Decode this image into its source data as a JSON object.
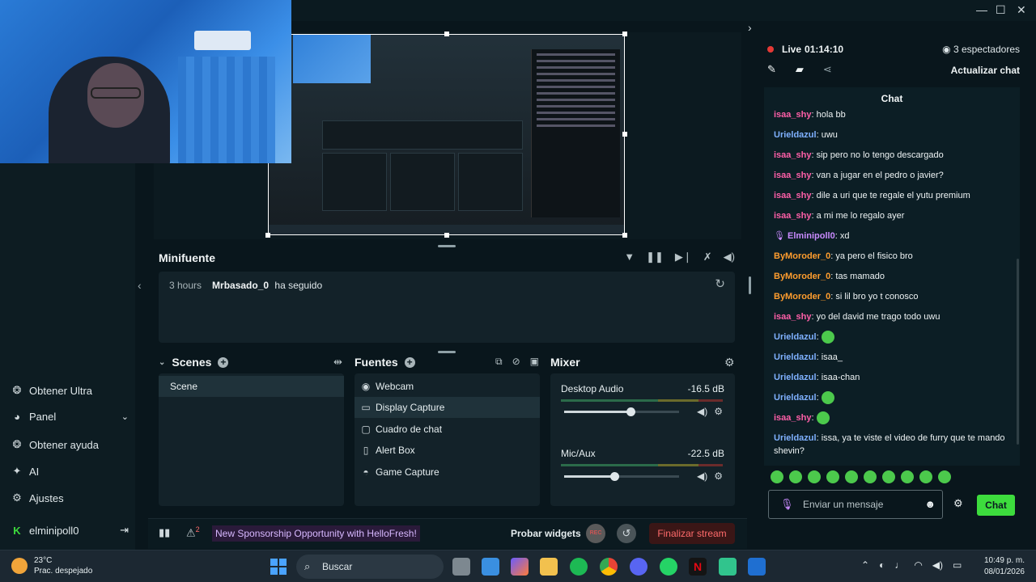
{
  "preview": {
    "minifuente_title": "Minifuente",
    "mini_event": {
      "time": "3 hours",
      "user": "Mrbasado_0",
      "action": "ha seguido"
    }
  },
  "sidebar": {
    "items": [
      {
        "label": "Obtener Ultra",
        "icon": "ultra-icon"
      },
      {
        "label": "Panel",
        "icon": "panel-icon"
      },
      {
        "label": "Obtener ayuda",
        "icon": "help-icon"
      },
      {
        "label": "AI",
        "icon": "ai-sparkle-icon"
      },
      {
        "label": "Ajustes",
        "icon": "gear-icon"
      }
    ],
    "account": "elminipoll0"
  },
  "scenes": {
    "title": "Scenes",
    "items": [
      "Scene"
    ]
  },
  "sources": {
    "title": "Fuentes",
    "items": [
      {
        "label": "Webcam",
        "icon": "camera-icon"
      },
      {
        "label": "Display Capture",
        "icon": "monitor-icon",
        "selected": true
      },
      {
        "label": "Cuadro de chat",
        "icon": "chat-box-icon"
      },
      {
        "label": "Alert Box",
        "icon": "alert-icon"
      },
      {
        "label": "Game Capture",
        "icon": "gamepad-icon"
      }
    ]
  },
  "mixer": {
    "title": "Mixer",
    "channels": [
      {
        "name": "Desktop Audio",
        "db": "-16.5 dB",
        "level": 0.58
      },
      {
        "name": "Mic/Aux",
        "db": "-22.5 dB",
        "level": 0.44
      }
    ]
  },
  "footer": {
    "alert_count": "2",
    "sponsor": "New Sponsorship Opportunity with HelloFresh!",
    "test_widgets": "Probar widgets",
    "rec_label": "REC",
    "end_stream": "Finalizar stream"
  },
  "chat": {
    "live_label": "Live",
    "live_time": "01:14:10",
    "viewers": "3 espectadores",
    "update_chat": "Actualizar chat",
    "header": "Chat",
    "messages": [
      {
        "user": "isaa_shy",
        "color": "#ff5fa8",
        "text": "hola bb"
      },
      {
        "user": "Urieldazul",
        "color": "#7fb1ff",
        "text": "uwu"
      },
      {
        "user": "isaa_shy",
        "color": "#ff5fa8",
        "text": "sip pero no lo tengo descargado"
      },
      {
        "user": "isaa_shy",
        "color": "#ff5fa8",
        "text": "van a jugar en el pedro o javier?"
      },
      {
        "user": "isaa_shy",
        "color": "#ff5fa8",
        "text": "dile a uri que te regale el yutu premium"
      },
      {
        "user": "isaa_shy",
        "color": "#ff5fa8",
        "text": "a mi me lo regalo ayer"
      },
      {
        "user": "Elminipoll0",
        "color": "#c98bff",
        "text": "xd"
      },
      {
        "user": "ByMoroder_0",
        "color": "#ff9d2e",
        "text": "ya pero el fisico bro"
      },
      {
        "user": "ByMoroder_0",
        "color": "#ff9d2e",
        "text": "tas mamado"
      },
      {
        "user": "ByMoroder_0",
        "color": "#ff9d2e",
        "text": "si lil bro yo t conosco"
      },
      {
        "user": "isaa_shy",
        "color": "#ff5fa8",
        "text": "yo del david me trago todo uwu"
      },
      {
        "user": "Urieldazul",
        "color": "#7fb1ff",
        "text": ""
      },
      {
        "user": "Urieldazul",
        "color": "#7fb1ff",
        "text": "isaa_"
      },
      {
        "user": "Urieldazul",
        "color": "#7fb1ff",
        "text": "isaa-chan"
      },
      {
        "user": "Urieldazul",
        "color": "#7fb1ff",
        "text": ""
      },
      {
        "user": "isaa_shy",
        "color": "#ff5fa8",
        "text": ""
      },
      {
        "user": "Urieldazul",
        "color": "#7fb1ff",
        "text": "issa, ya te viste el video de furry que te mando shevin?"
      }
    ],
    "input_placeholder": "Enviar un mensaje",
    "send_label": "Chat"
  },
  "taskbar": {
    "temperature": "23°C",
    "weather": "Prac. despejado",
    "search_placeholder": "Buscar",
    "time": "10:49 p. m.",
    "date": "08/01/2026"
  }
}
